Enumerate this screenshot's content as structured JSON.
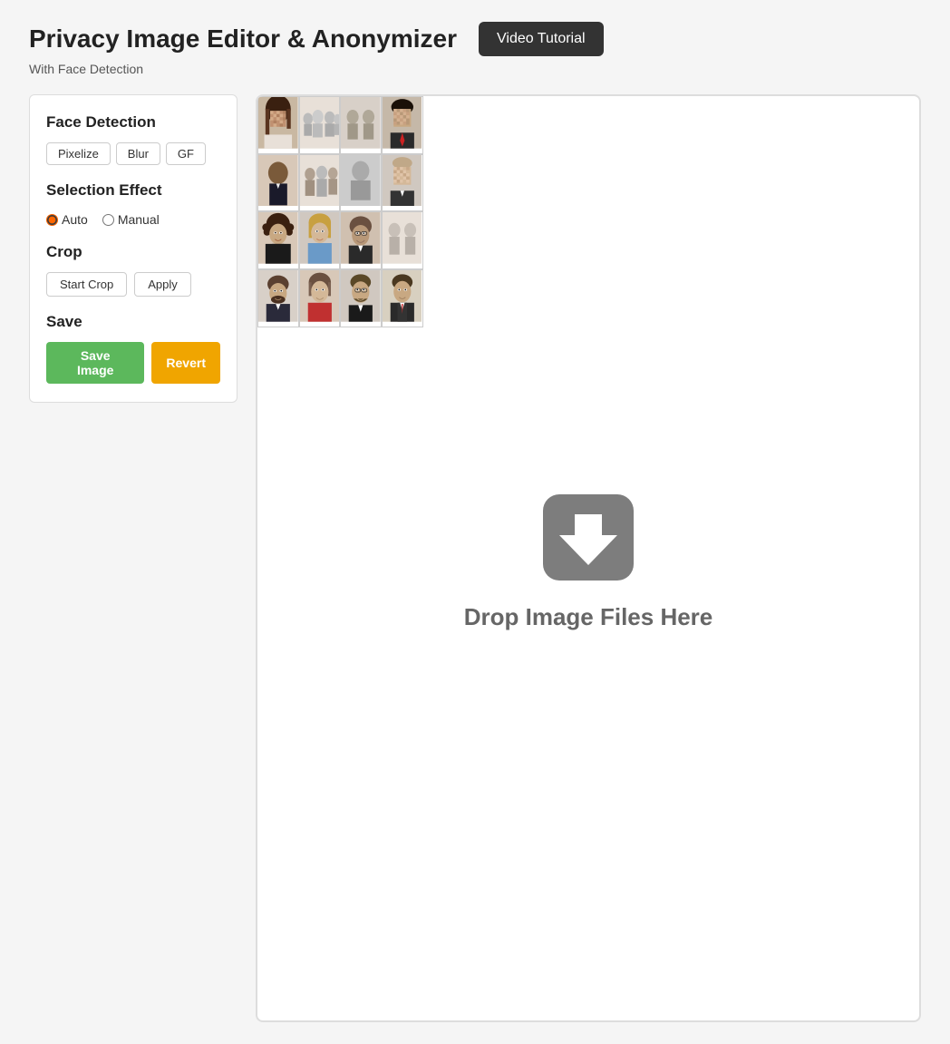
{
  "header": {
    "title": "Privacy Image Editor & Anonymizer",
    "video_tutorial_label": "Video Tutorial",
    "subtitle": "With Face Detection"
  },
  "sidebar": {
    "face_detection": {
      "title": "Face Detection",
      "buttons": [
        {
          "label": "Pixelize",
          "id": "pixelize"
        },
        {
          "label": "Blur",
          "id": "blur"
        },
        {
          "label": "GF",
          "id": "gf"
        }
      ]
    },
    "selection_effect": {
      "title": "Selection Effect",
      "options": [
        {
          "label": "Auto",
          "value": "auto",
          "checked": true
        },
        {
          "label": "Manual",
          "value": "manual",
          "checked": false
        }
      ]
    },
    "crop": {
      "title": "Crop",
      "buttons": [
        {
          "label": "Start Crop",
          "id": "start-crop"
        },
        {
          "label": "Apply",
          "id": "apply"
        }
      ]
    },
    "save": {
      "title": "Save",
      "save_label": "Save Image",
      "revert_label": "Revert"
    }
  },
  "drop_zone": {
    "text": "Drop Image Files Here"
  }
}
